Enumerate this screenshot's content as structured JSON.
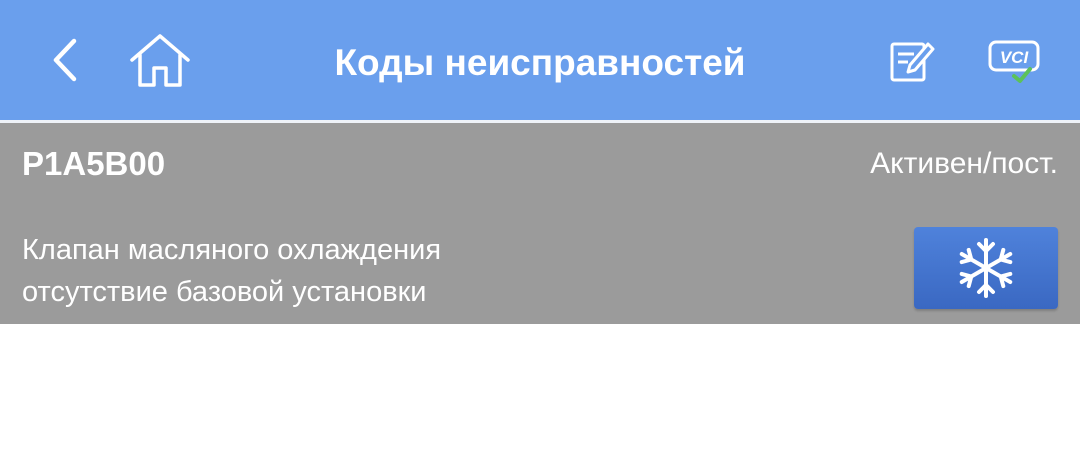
{
  "header": {
    "title": "Коды неисправностей",
    "icons": {
      "back": "chevron-left-icon",
      "home": "home-icon",
      "edit": "edit-report-icon",
      "vci": "vci-connected-icon"
    },
    "vci_label": "VCI"
  },
  "dtc_list": [
    {
      "code": "P1A5B00",
      "status": "Активен/пост.",
      "description_lines": [
        "Клапан масляного охлаждения",
        "отсутствие базовой установки"
      ],
      "action_icon": "snowflake-icon"
    }
  ],
  "colors": {
    "header_bg": "#6a9fed",
    "row_bg": "#9b9b9b",
    "freeze_button": "#4675cf",
    "vci_check": "#5cc25a",
    "text": "#ffffff"
  }
}
